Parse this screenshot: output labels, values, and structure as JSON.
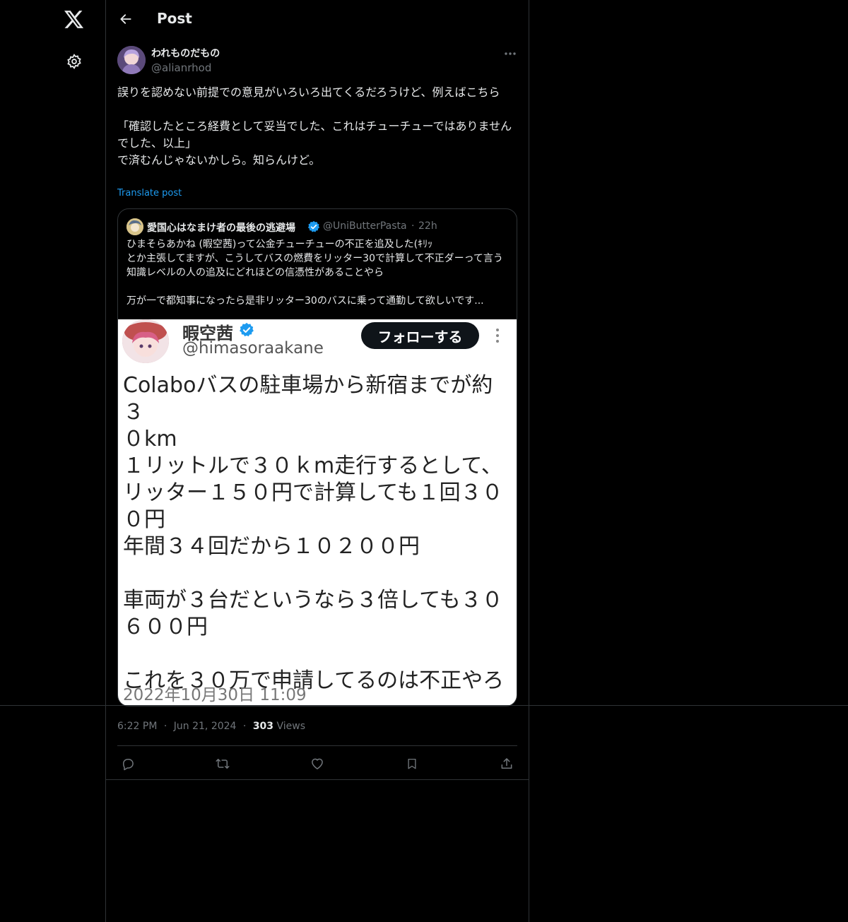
{
  "nav": {
    "logo_icon": "x-logo-icon",
    "settings_icon": "gear-icon"
  },
  "header": {
    "title": "Post"
  },
  "tweet": {
    "display_name": "われものだもの",
    "handle": "@alianrhod",
    "text": "誤りを認めない前提での意見がいろいろ出てくるだろうけど、例えばこちら\n\n「確認したところ経費として妥当でした、これはチューチューではありませんでした、以上」\nで済むんじゃないかしら。知らんけど。",
    "translate_label": "Translate post"
  },
  "quote": {
    "display_name": "愛国心はなまけ者の最後の逃避場",
    "handle": "@UniButterPasta",
    "dot": "·",
    "time": "22h",
    "text": "ひまそらあかね (暇空茜)って公金チューチューの不正を追及した(ｷﾘｯ\nとか主張してますが、こうしてバスの燃費をリッター30で計算して不正ダーって言う知識レベルの人の追及にどれほどの信憑性があることやら\n\n万が一で都知事になったら是非リッター30のバスに乗って通勤して欲しいです..."
  },
  "screenshot": {
    "name": "暇空茜",
    "handle": "@himasoraakane",
    "follow_label": "フォローする",
    "body": "Colaboバスの駐車場から新宿までが約３\n０km\n１リットルで３０ｋm走行するとして、\nリッター１５０円で計算しても１回３０\n０円\n年間３４回だから１０２００円\n\n車両が３台だというなら３倍しても３０\n６００円\n\nこれを３０万で申請してるのは不正やろ",
    "date": "2022年10月30日 11:09"
  },
  "meta": {
    "time": "6:22 PM",
    "dot1": "·",
    "date": "Jun 21, 2024",
    "dot2": "·",
    "views_count": "303",
    "views_label": "Views"
  },
  "colors": {
    "background": "#000000",
    "text": "#e7e9ea",
    "muted": "#71767b",
    "accent": "#1d9bf0",
    "border": "#2f3336"
  }
}
